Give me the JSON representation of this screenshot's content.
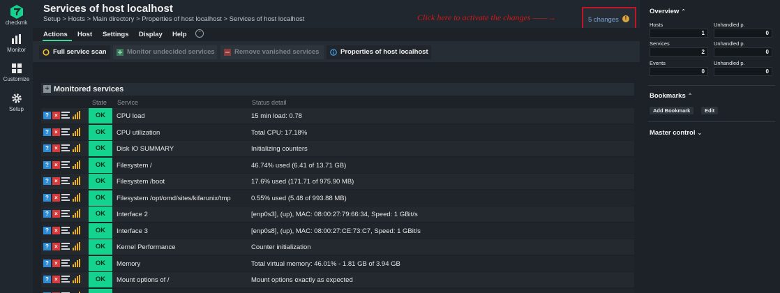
{
  "app": {
    "logo_text": "checkmk"
  },
  "leftnav": {
    "items": [
      {
        "label": "Monitor",
        "icon": "bar-chart-icon"
      },
      {
        "label": "Customize",
        "icon": "grid-icon"
      },
      {
        "label": "Setup",
        "icon": "gear-icon"
      }
    ]
  },
  "header": {
    "title": "Services of host localhost",
    "breadcrumb": "Setup > Hosts > Main directory > Properties of host localhost > Services of host localhost",
    "annotation": "Click here to activate the changes ——→",
    "changes_label": "5 changes",
    "changes_badge": "!"
  },
  "menubar": {
    "items": [
      "Actions",
      "Host",
      "Settings",
      "Display",
      "Help"
    ],
    "collapse_icon": "chevron-up-icon"
  },
  "actions": [
    {
      "label": "Full service scan",
      "state": "enabled",
      "icon": "refresh-icon"
    },
    {
      "label": "Monitor undecided services",
      "state": "disabled",
      "icon": "plus-icon"
    },
    {
      "label": "Remove vanished services",
      "state": "disabled",
      "icon": "minus-icon"
    },
    {
      "label": "Properties of host localhost",
      "state": "enabled",
      "icon": "info-icon"
    }
  ],
  "services": {
    "section_title": "Monitored services",
    "columns": {
      "state": "State",
      "service": "Service",
      "status": "Status detail"
    },
    "rows": [
      {
        "state": "OK",
        "service": "CPU load",
        "detail": "15 min load: 0.78"
      },
      {
        "state": "OK",
        "service": "CPU utilization",
        "detail": "Total CPU: 17.18%"
      },
      {
        "state": "OK",
        "service": "Disk IO SUMMARY",
        "detail": "Initializing counters"
      },
      {
        "state": "OK",
        "service": "Filesystem /",
        "detail": "46.74% used (6.41 of 13.71 GB)"
      },
      {
        "state": "OK",
        "service": "Filesystem /boot",
        "detail": "17.6% used (171.71 of 975.90 MB)"
      },
      {
        "state": "OK",
        "service": "Filesystem /opt/omd/sites/kifarunix/tmp",
        "detail": "0.55% used (5.48 of 993.88 MB)"
      },
      {
        "state": "OK",
        "service": "Interface 2",
        "detail": "[enp0s3], (up), MAC: 08:00:27:79:66:34, Speed: 1 GBit/s"
      },
      {
        "state": "OK",
        "service": "Interface 3",
        "detail": "[enp0s8], (up), MAC: 08:00:27:CE:73:C7, Speed: 1 GBit/s"
      },
      {
        "state": "OK",
        "service": "Kernel Performance",
        "detail": "Counter initialization"
      },
      {
        "state": "OK",
        "service": "Memory",
        "detail": "Total virtual memory: 46.01% - 1.81 GB of 3.94 GB"
      },
      {
        "state": "OK",
        "service": "Mount options of /",
        "detail": "Mount options exactly as expected"
      },
      {
        "state": "OK",
        "service": "",
        "detail": ""
      }
    ]
  },
  "overview": {
    "title": "Overview",
    "stats": [
      {
        "label": "Hosts",
        "value": "1",
        "unhandled_label": "Unhandled p.",
        "unhandled": "0"
      },
      {
        "label": "Services",
        "value": "2",
        "unhandled_label": "Unhandled p.",
        "unhandled": "0"
      },
      {
        "label": "Events",
        "value": "0",
        "unhandled_label": "Unhandled p.",
        "unhandled": "0"
      }
    ]
  },
  "bookmarks": {
    "title": "Bookmarks",
    "add_label": "Add Bookmark",
    "edit_label": "Edit"
  },
  "master_control": {
    "title": "Master control"
  },
  "colors": {
    "ok": "#13d38e",
    "accent": "#3fd69b",
    "changes_border": "#c1162a",
    "annotation": "#d21818"
  }
}
